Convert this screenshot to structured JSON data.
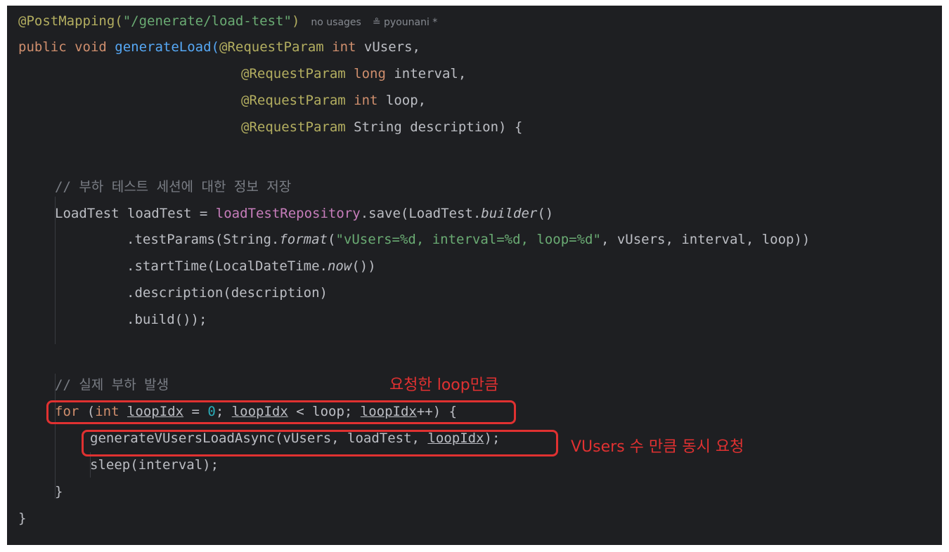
{
  "code": {
    "l1": {
      "annotation": "@PostMapping(",
      "path": "\"/generate/load-test\"",
      "close": ")",
      "usages": "no usages",
      "author": "pyounani *"
    },
    "l2": {
      "kw": "public void ",
      "name": "generateLoad(",
      "ann": "@RequestParam ",
      "type": "int ",
      "param": "vUsers,"
    },
    "l3": {
      "ann": "@RequestParam ",
      "type": "long ",
      "param": "interval,"
    },
    "l4": {
      "ann": "@RequestParam ",
      "type": "int ",
      "param": "loop,"
    },
    "l5": {
      "ann": "@RequestParam ",
      "rest": "String description) {"
    },
    "l6": {
      "comment": "// 부하 테스트 세션에 대한 정보 저장"
    },
    "l7": {
      "a": "LoadTest loadTest = ",
      "field": "loadTestRepository",
      "b": ".save(LoadTest.",
      "italic": "builder",
      "c": "()"
    },
    "l8": {
      "a": ".testParams(String.",
      "italic": "format",
      "b": "(",
      "str": "\"vUsers=%d, interval=%d, loop=%d\"",
      "c": ", vUsers, interval, loop))"
    },
    "l9": {
      "a": ".startTime(LocalDateTime.",
      "italic": "now",
      "b": "())"
    },
    "l10": {
      "a": ".description(description)"
    },
    "l11": {
      "a": ".build());"
    },
    "l12": {
      "comment": "// 실제 부하 발생"
    },
    "l13": {
      "kw": "for ",
      "a": "(",
      "kw2": "int ",
      "var1": "loopIdx",
      "b": " = ",
      "num": "0",
      "c": "; ",
      "var2": "loopIdx",
      "d": " < loop; ",
      "var3": "loopIdx",
      "e": "++) {"
    },
    "l14": {
      "a": "generateVUsersLoadAsync(vUsers, loadTest, ",
      "var": "loopIdx",
      "b": ");"
    },
    "l15": {
      "a": "sleep(interval);"
    },
    "l16": {
      "a": "}"
    },
    "l17": {
      "a": "}"
    }
  },
  "annotations": {
    "loop_note": "요청한 loop만큼",
    "vusers_note": "VUsers 수 만큼 동시 요청"
  },
  "colors": {
    "background": "#1e1f22",
    "keyword": "#cf8e6d",
    "annotation": "#b3ae60",
    "string": "#6aab73",
    "field": "#c77dbb",
    "comment": "#7a7e85",
    "number": "#2aacb8",
    "highlight": "#e03131"
  }
}
